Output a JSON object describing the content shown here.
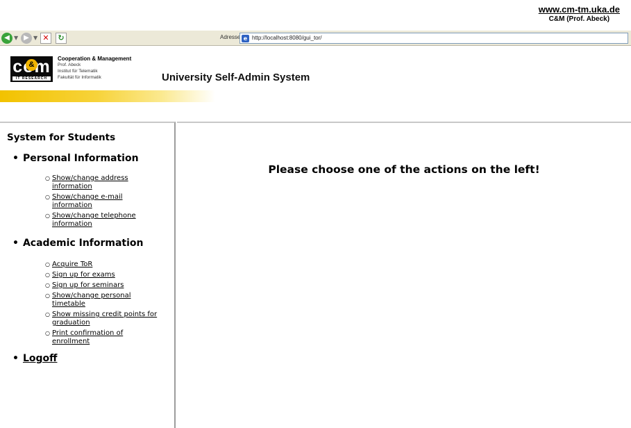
{
  "attribution": {
    "url": "www.cm-tm.uka.de",
    "credit": "C&M (Prof. Abeck)"
  },
  "browser": {
    "address_label": "Adresse",
    "address_url": "http://localhost:8080/gui_tor/"
  },
  "header": {
    "logo_text": "com",
    "logo_amp": "&",
    "logo_sub": "IT RESEARCH",
    "org_name": "Cooperation & Management",
    "org_lines": [
      "Prof. Abeck",
      "Institut für Telematik",
      "Fakultät für Informatik"
    ],
    "system_title": "University Self-Admin System",
    "band_color": "#f2c200"
  },
  "sidebar": {
    "title": "System for Students",
    "sections": [
      {
        "label": "Personal Information",
        "links": [
          "Show/change address information",
          "Show/change e-mail information",
          "Show/change telephone information"
        ]
      },
      {
        "label": "Academic Information",
        "links": [
          "Acquire ToR",
          "Sign up for exams",
          "Sign up for seminars",
          "Show/change personal timetable",
          "Show missing credit points for graduation",
          "Print confirmation of enrollment"
        ]
      }
    ],
    "logoff": "Logoff"
  },
  "content": {
    "message": "Please choose one of the actions on the left!"
  }
}
